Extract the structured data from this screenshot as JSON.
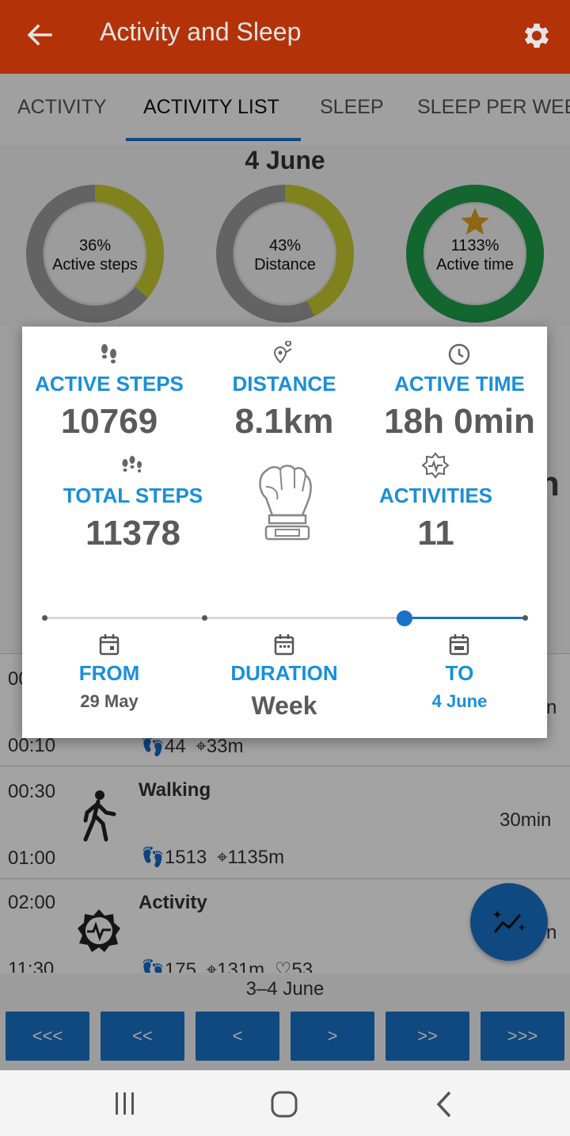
{
  "colors": {
    "appbar": "#c8380a",
    "accent_blue": "#1a72c9",
    "label_blue": "#1a8fd9",
    "ring_yellow": "#c8cc30",
    "ring_green": "#1fa04a",
    "ring_grey": "#9b9b9b"
  },
  "appbar": {
    "title": "Activity and Sleep",
    "back_icon": "arrow-left-icon",
    "settings_icon": "gear-icon"
  },
  "tabs": [
    {
      "label": "ACTIVITY",
      "active": false
    },
    {
      "label": "ACTIVITY LIST",
      "active": true
    },
    {
      "label": "SLEEP",
      "active": false
    },
    {
      "label": "SLEEP PER WEE",
      "active": false
    }
  ],
  "date_title": "4 June",
  "rings": [
    {
      "percent_text": "36%",
      "label": "Active steps",
      "fill": 0.36,
      "star": false
    },
    {
      "percent_text": "43%",
      "label": "Distance",
      "fill": 0.43,
      "star": false
    },
    {
      "percent_text": "1133%",
      "label": "Active time",
      "fill": 1.0,
      "star": true
    }
  ],
  "background": {
    "partial_letter": "n",
    "partial_row": {
      "start_time": "00",
      "end_time": "00:10",
      "duration": "n",
      "steps": "44",
      "distance": "33m"
    },
    "rows": [
      {
        "start_time": "00:30",
        "end_time": "01:00",
        "title": "Walking",
        "duration": "30min",
        "steps": "1513",
        "distance": "1135m",
        "icon": "walking-person-icon"
      },
      {
        "start_time": "02:00",
        "end_time": "11:30",
        "title": "Activity",
        "duration": "n",
        "steps": "175",
        "distance": "131m",
        "heart": "53",
        "icon": "activity-badge-icon"
      }
    ]
  },
  "range_label": "3–4 June",
  "nav_buttons": [
    "<<<",
    "<<",
    "<",
    ">",
    ">>",
    ">>>"
  ],
  "dialog": {
    "active_steps": {
      "label": "ACTIVE STEPS",
      "value": "10769"
    },
    "distance": {
      "label": "DISTANCE",
      "value": "8.1km"
    },
    "active_time": {
      "label": "ACTIVE TIME",
      "value": "18h 0min"
    },
    "total_steps": {
      "label": "TOTAL STEPS",
      "value": "11378"
    },
    "activities": {
      "label": "ACTIVITIES",
      "value": "11"
    },
    "from": {
      "label": "FROM",
      "value": "29 May"
    },
    "duration": {
      "label": "DURATION",
      "value": "Week"
    },
    "to": {
      "label": "TO",
      "value": "4 June"
    },
    "slider_position": 0.75
  }
}
